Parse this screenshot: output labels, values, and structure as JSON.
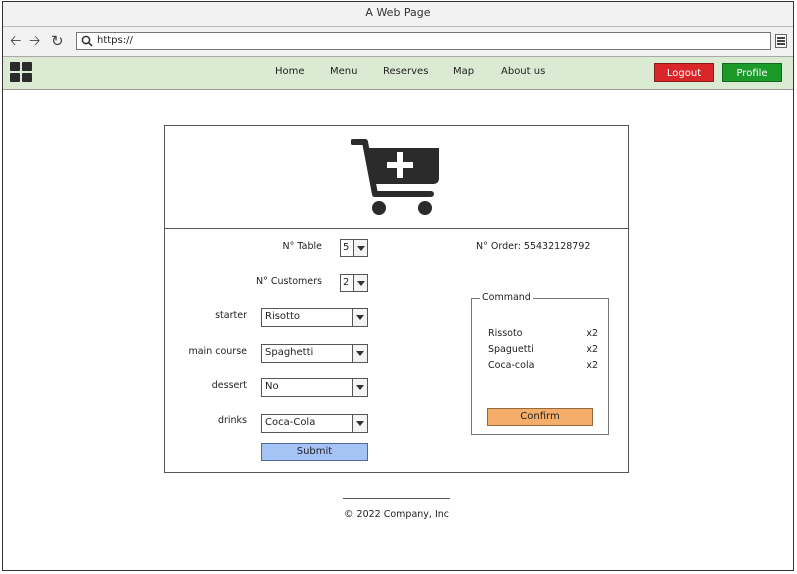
{
  "window": {
    "title": "A Web Page"
  },
  "browser": {
    "url": "https://",
    "icons": [
      "back-arrow-icon",
      "forward-arrow-icon",
      "reload-icon",
      "search-icon",
      "hamburger-menu-icon"
    ]
  },
  "nav": {
    "logo_icon": "grid-logo-icon",
    "links": [
      "Home",
      "Menu",
      "Reserves",
      "Map",
      "About us"
    ],
    "logout": "Logout",
    "profile": "Profile",
    "colors": {
      "background": "#dbead3",
      "logout": "#d9262a",
      "profile": "#1b9a2a"
    }
  },
  "hero": {
    "icon": "add-to-cart-icon"
  },
  "form": {
    "table": {
      "label": "N° Table",
      "value": "5"
    },
    "customers": {
      "label": "N° Customers",
      "value": "2"
    },
    "starter": {
      "label": "starter",
      "value": "Risotto"
    },
    "main": {
      "label": "main course",
      "value": "Spaghetti"
    },
    "dessert": {
      "label": "dessert",
      "value": "No"
    },
    "drinks": {
      "label": "drinks",
      "value": "Coca-Cola"
    },
    "submit": "Submit"
  },
  "order": {
    "number_label": "N° Order: 55432128792",
    "command_title": "Command",
    "items": [
      {
        "name": "Rissoto",
        "qty": "x2"
      },
      {
        "name": "Spaguetti",
        "qty": "x2"
      },
      {
        "name": "Coca-cola",
        "qty": "x2"
      }
    ],
    "confirm": "Confirm"
  },
  "footer": {
    "text": "© 2022 Company, Inc"
  }
}
